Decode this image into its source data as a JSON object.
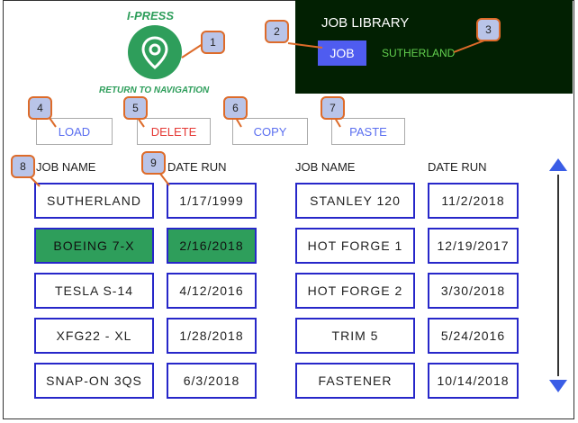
{
  "header": {
    "brand": "I-PRESS",
    "return_label": "RETURN TO NAVIGATION"
  },
  "library": {
    "title": "JOB LIBRARY",
    "job_button": "JOB",
    "current_job": "SUTHERLAND"
  },
  "actions": {
    "load": "LOAD",
    "delete": "DELETE",
    "copy": "COPY",
    "paste": "PASTE"
  },
  "columns": {
    "left_job_header": "JOB NAME",
    "left_date_header": "DATE RUN",
    "right_job_header": "JOB NAME",
    "right_date_header": "DATE RUN"
  },
  "jobs_left": [
    {
      "name": "SUTHERLAND",
      "date": "1/17/1999"
    },
    {
      "name": "BOEING 7-X",
      "date": "2/16/2018"
    },
    {
      "name": "TESLA S-14",
      "date": "4/12/2016"
    },
    {
      "name": "XFG22 - XL",
      "date": "1/28/2018"
    },
    {
      "name": "SNAP-ON 3QS",
      "date": "6/3/2018"
    }
  ],
  "jobs_right": [
    {
      "name": "STANLEY 120",
      "date": "11/2/2018"
    },
    {
      "name": "HOT FORGE 1",
      "date": "12/19/2017"
    },
    {
      "name": "HOT FORGE 2",
      "date": "3/30/2018"
    },
    {
      "name": "TRIM 5",
      "date": "5/24/2016"
    },
    {
      "name": "FASTENER",
      "date": "10/14/2018"
    }
  ],
  "callouts": [
    "1",
    "2",
    "3",
    "4",
    "5",
    "6",
    "7",
    "8",
    "9"
  ],
  "colors": {
    "brand_green": "#2e9e5b",
    "library_bg": "#022002",
    "job_button": "#4f5cf0",
    "cell_border": "#2727c9",
    "delete_red": "#e53935",
    "scroll_arrow": "#3a5de6",
    "callout_border": "#dd6b2a"
  }
}
